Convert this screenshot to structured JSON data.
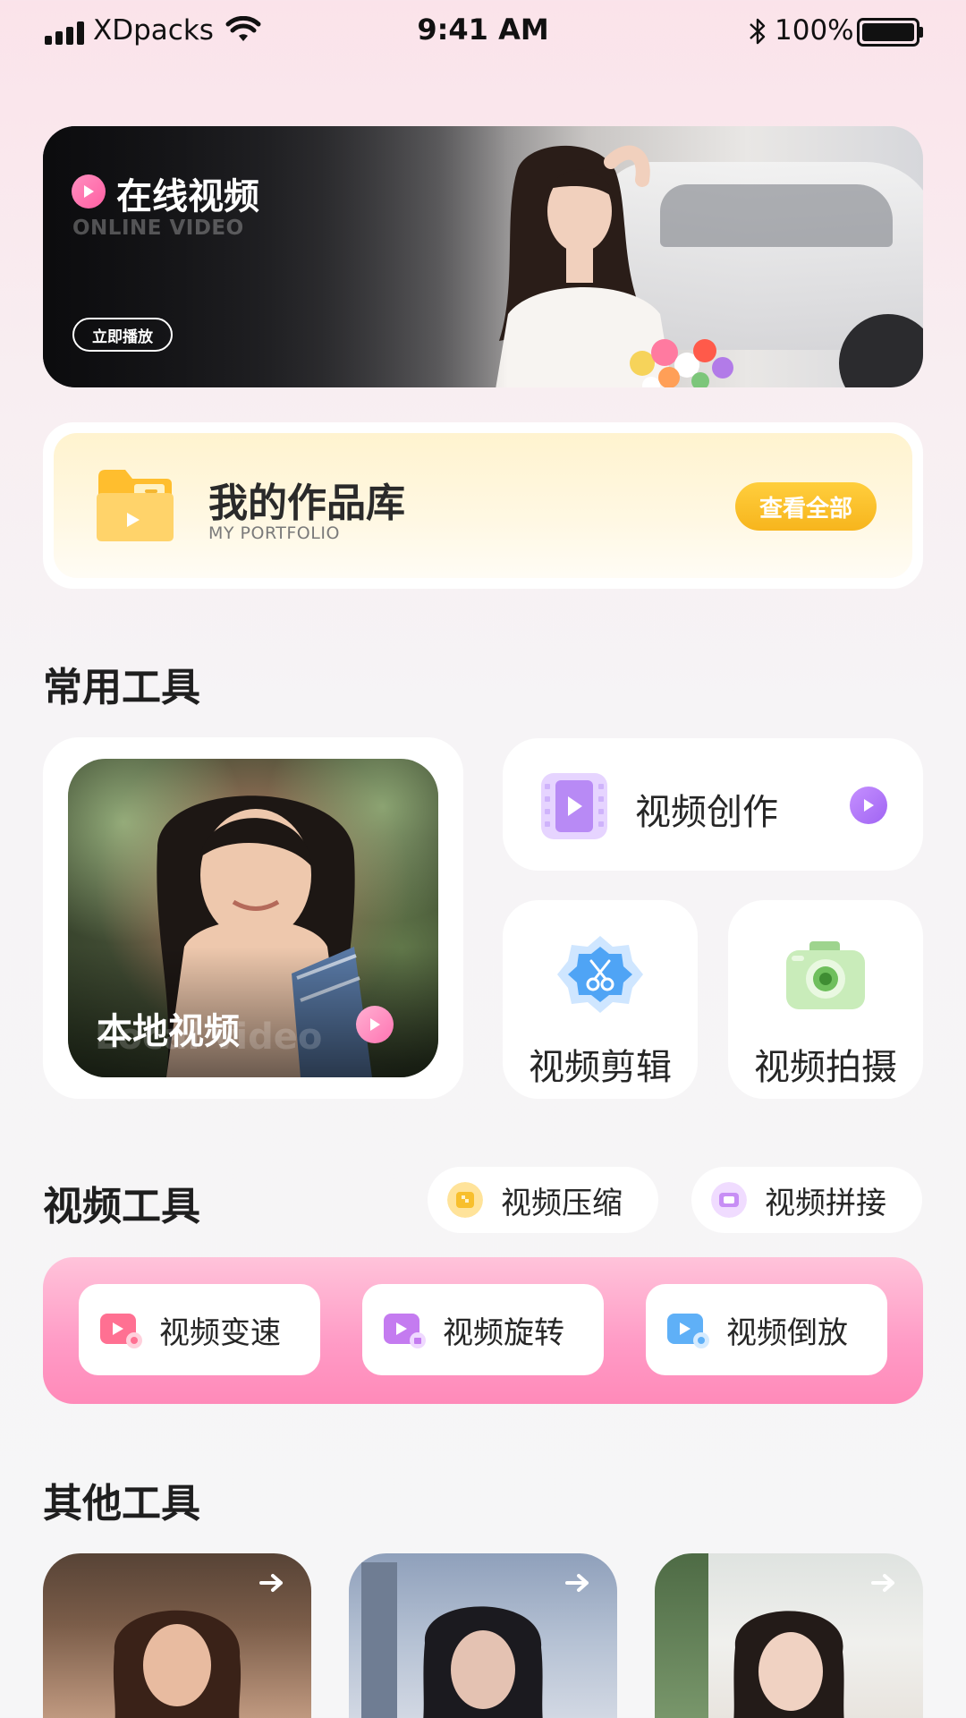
{
  "status_bar": {
    "carrier": "XDpacks",
    "time": "9:41 AM",
    "battery_percent": "100%",
    "battery_level": 1.0
  },
  "hero": {
    "title": "在线视频",
    "subtitle": "ONLINE VIDEO",
    "button_label": "立即播放"
  },
  "portfolio": {
    "title": "我的作品库",
    "subtitle": "MY PORTFOLIO",
    "button_label": "查看全部"
  },
  "common_tools": {
    "title": "常用工具",
    "local_video": {
      "title": "本地视频",
      "subtitle": "Local video"
    },
    "create": {
      "label": "视频创作"
    },
    "edit": {
      "label": "视频剪辑"
    },
    "shoot": {
      "label": "视频拍摄"
    }
  },
  "video_tools": {
    "title": "视频工具",
    "chips": [
      {
        "label": "视频压缩",
        "icon": "compress-icon"
      },
      {
        "label": "视频拼接",
        "icon": "splice-icon"
      }
    ],
    "buttons": [
      {
        "label": "视频变速",
        "icon": "speed-icon"
      },
      {
        "label": "视频旋转",
        "icon": "rotate-icon"
      },
      {
        "label": "视频倒放",
        "icon": "reverse-icon"
      }
    ]
  },
  "other_tools": {
    "title": "其他工具"
  },
  "colors": {
    "accent_pink": "#ff8ab9",
    "accent_yellow": "#f7b51d",
    "accent_purple": "#a064f3"
  }
}
